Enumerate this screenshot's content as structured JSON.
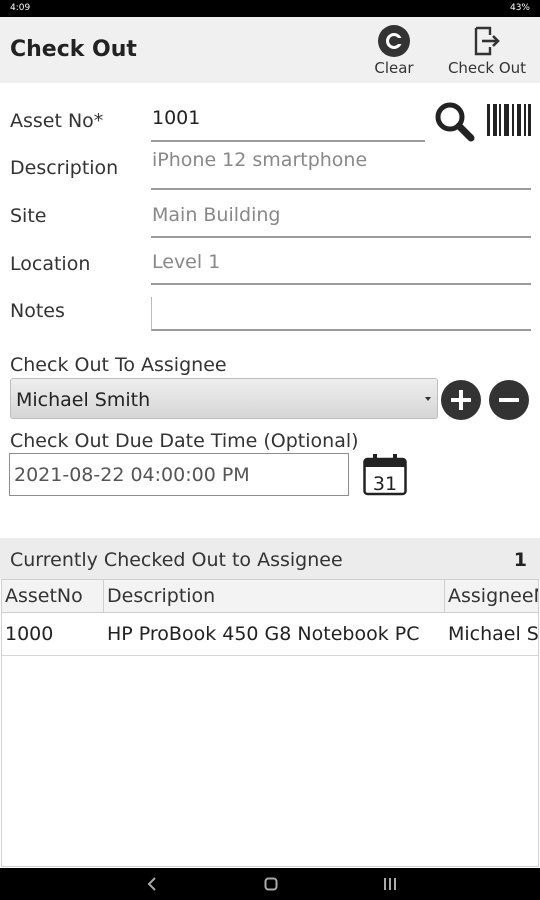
{
  "statusbar": {
    "time": "4:09",
    "right": "43%"
  },
  "appbar": {
    "title": "Check Out",
    "clear_label": "Clear",
    "checkout_label": "Check Out"
  },
  "form": {
    "asset_no_label": "Asset No*",
    "asset_no_value": "1001",
    "description_label": "Description",
    "description_value": "iPhone 12 smartphone",
    "site_label": "Site",
    "site_value": "Main Building",
    "location_label": "Location",
    "location_value": "Level 1",
    "notes_label": "Notes",
    "notes_value": "",
    "assignee_label": "Check Out To Assignee",
    "assignee_value": "Michael Smith",
    "due_label": "Check Out Due Date Time (Optional)",
    "due_value": "2021-08-22 04:00:00 PM",
    "calendar_day": "31"
  },
  "grid": {
    "title": "Currently Checked Out to Assignee",
    "count": "1",
    "columns": [
      "AssetNo",
      "Description",
      "AssigneeN"
    ],
    "rows": [
      [
        "1000",
        "HP ProBook 450 G8 Notebook PC",
        "Michael S"
      ]
    ]
  },
  "icons": {
    "search": "search-icon",
    "barcode": "barcode-icon",
    "calendar": "calendar-icon",
    "add": "plus-icon",
    "remove": "minus-icon"
  }
}
